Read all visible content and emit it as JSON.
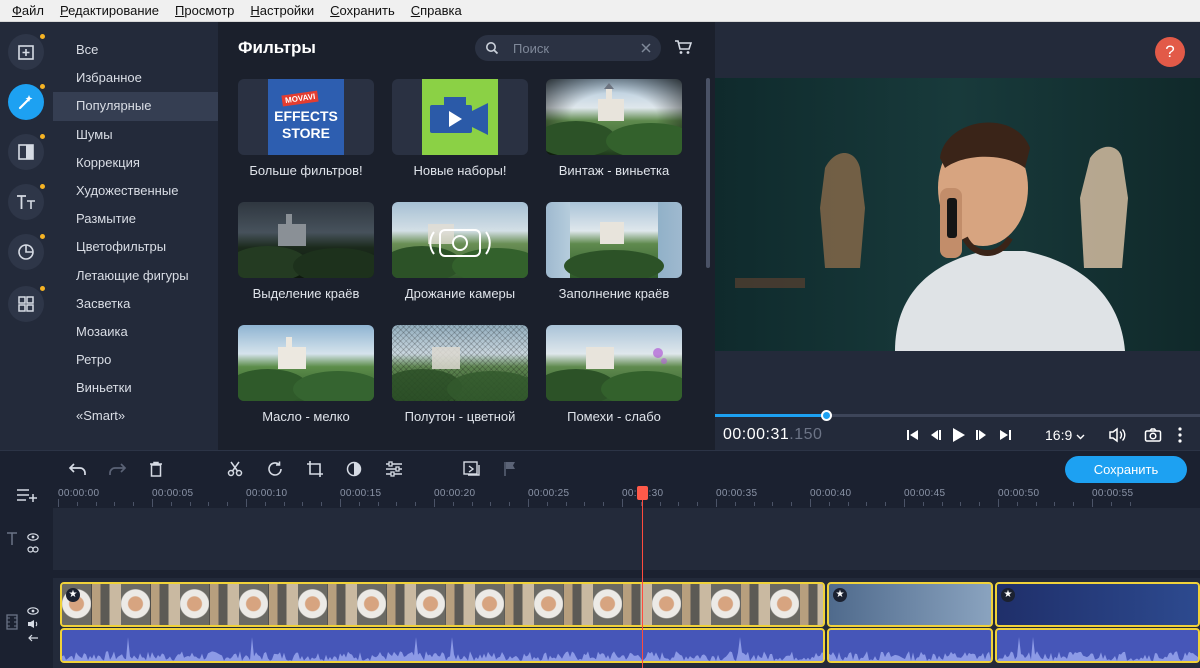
{
  "menu": [
    "Файл",
    "Редактирование",
    "Просмотр",
    "Настройки",
    "Сохранить",
    "Справка"
  ],
  "rail": [
    {
      "icon": "import-icon",
      "dot": true
    },
    {
      "icon": "filters-magic-wand-icon",
      "dot": true,
      "active": true
    },
    {
      "icon": "transitions-icon",
      "dot": true
    },
    {
      "icon": "titles-icon",
      "dot": true
    },
    {
      "icon": "stickers-icon",
      "dot": true
    },
    {
      "icon": "more-tools-icon",
      "dot": true
    }
  ],
  "categories": [
    "Все",
    "Избранное",
    "Популярные",
    "Шумы",
    "Коррекция",
    "Художественные",
    "Размытие",
    "Цветофильтры",
    "Летающие фигуры",
    "Засветка",
    "Мозаика",
    "Ретро",
    "Виньетки",
    "«Smart»"
  ],
  "active_category": "Популярные",
  "gallery": {
    "title": "Фильтры",
    "search_placeholder": "Поиск",
    "store_logo": {
      "brand": "MOVAVI",
      "line1": "EFFECTS",
      "line2": "STORE"
    },
    "tiles": [
      {
        "label": "Больше фильтров!",
        "kind": "store"
      },
      {
        "label": "Новые наборы!",
        "kind": "camera"
      },
      {
        "label": "Винтаж - виньетка",
        "kind": "vignette"
      },
      {
        "label": "Выделение краёв",
        "kind": "edges"
      },
      {
        "label": "Дрожание камеры",
        "kind": "shake"
      },
      {
        "label": "Заполнение краёв",
        "kind": "fill"
      },
      {
        "label": "Масло - мелко",
        "kind": "oil"
      },
      {
        "label": "Полутон - цветной",
        "kind": "halftone"
      },
      {
        "label": "Помехи - слабо",
        "kind": "noise"
      }
    ]
  },
  "preview": {
    "help_label": "?",
    "timecode_main": "00:00:31",
    "timecode_ms": ".150",
    "aspect": "16:9",
    "progress": 0.228
  },
  "timeline": {
    "save_label": "Сохранить",
    "ruler": [
      "00:00:00",
      "00:00:05",
      "00:00:10",
      "00:00:15",
      "00:00:20",
      "00:00:25",
      "00:00:30",
      "00:00:35",
      "00:00:40",
      "00:00:45",
      "00:00:50",
      "00:00:55"
    ]
  },
  "colors": {
    "accent": "#1da1f2",
    "clip_border": "#f0d23a",
    "playhead": "#ff4b3d",
    "help": "#e25a48",
    "badge": "#f5b324"
  }
}
